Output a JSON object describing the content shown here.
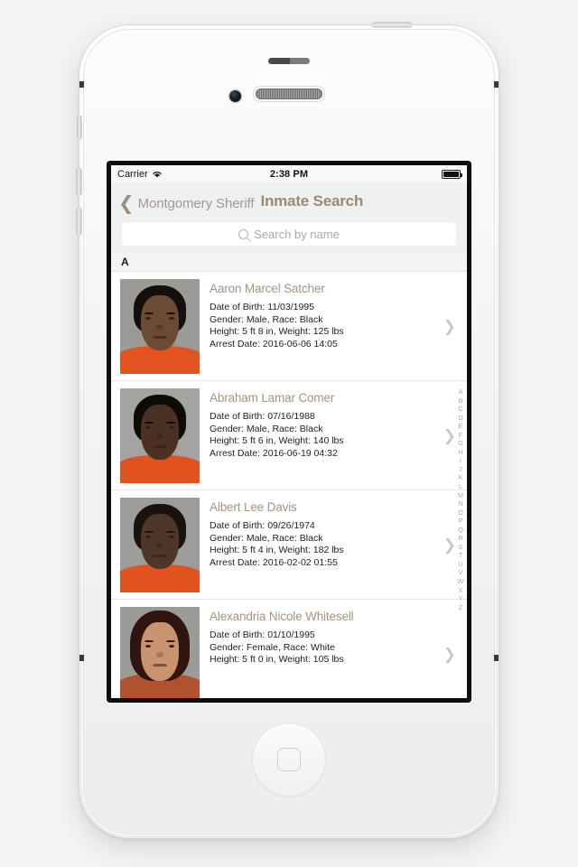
{
  "status_bar": {
    "carrier": "Carrier",
    "wifi_icon": "wifi-icon",
    "time": "2:38 PM",
    "battery_icon": "battery-full-icon"
  },
  "nav_bar": {
    "back_chevron_icon": "chevron-left-icon",
    "back_label": "Montgomery Sheriff",
    "title": "Inmate Search"
  },
  "search": {
    "icon": "search-icon",
    "placeholder": "Search by name",
    "value": ""
  },
  "section_header": "A",
  "accent_color": "#a6937e",
  "inmates": [
    {
      "name": "Aaron Marcel Satcher",
      "dob": "Date of Birth: 11/03/1995",
      "gender_race": "Gender: Male, Race: Black",
      "height_weight": "Height: 5 ft 8 in, Weight: 125 lbs",
      "arrest": "Arrest Date: 2016-06-06 14:05",
      "skin": "#6b4a36",
      "hair": "#140f0c",
      "jumpsuit": "#e3521f",
      "bg": "#9a9a96"
    },
    {
      "name": "Abraham Lamar Comer",
      "dob": "Date of Birth: 07/16/1988",
      "gender_race": "Gender: Male, Race: Black",
      "height_weight": "Height: 5 ft 6 in, Weight: 140 lbs",
      "arrest": "Arrest Date: 2016-06-19 04:32",
      "skin": "#4a3124",
      "hair": "#0d0a08",
      "jumpsuit": "#e0531f",
      "bg": "#a3a39f"
    },
    {
      "name": "Albert Lee Davis",
      "dob": "Date of Birth: 09/26/1974",
      "gender_race": "Gender: Male, Race: Black",
      "height_weight": "Height: 5 ft 4 in, Weight: 182 lbs",
      "arrest": "Arrest Date: 2016-02-02 01:55",
      "skin": "#4f362a",
      "hair": "#1a120e",
      "jumpsuit": "#e2521e",
      "bg": "#9c9c98"
    },
    {
      "name": "Alexandria Nicole Whitesell",
      "dob": "Date of Birth: 01/10/1995",
      "gender_race": "Gender: Female, Race: White",
      "height_weight": "Height: 5 ft 0 in, Weight: 105 lbs",
      "arrest": "",
      "skin": "#c9936f",
      "hair": "#30150f",
      "jumpsuit": "#b0512f",
      "bg": "#9b9b97"
    }
  ],
  "alphabet_index": [
    "A",
    "B",
    "C",
    "D",
    "E",
    "F",
    "G",
    "H",
    "I",
    "J",
    "K",
    "L",
    "M",
    "N",
    "O",
    "P",
    "Q",
    "R",
    "S",
    "T",
    "U",
    "V",
    "W",
    "X",
    "Y",
    "Z"
  ],
  "row_chevron_icon": "chevron-right-icon",
  "device": {
    "home_button_icon": "home-square-icon",
    "camera_icon": "front-camera-icon",
    "speaker_icon": "earpiece-speaker-icon",
    "sensor_icon": "proximity-sensor-icon"
  }
}
